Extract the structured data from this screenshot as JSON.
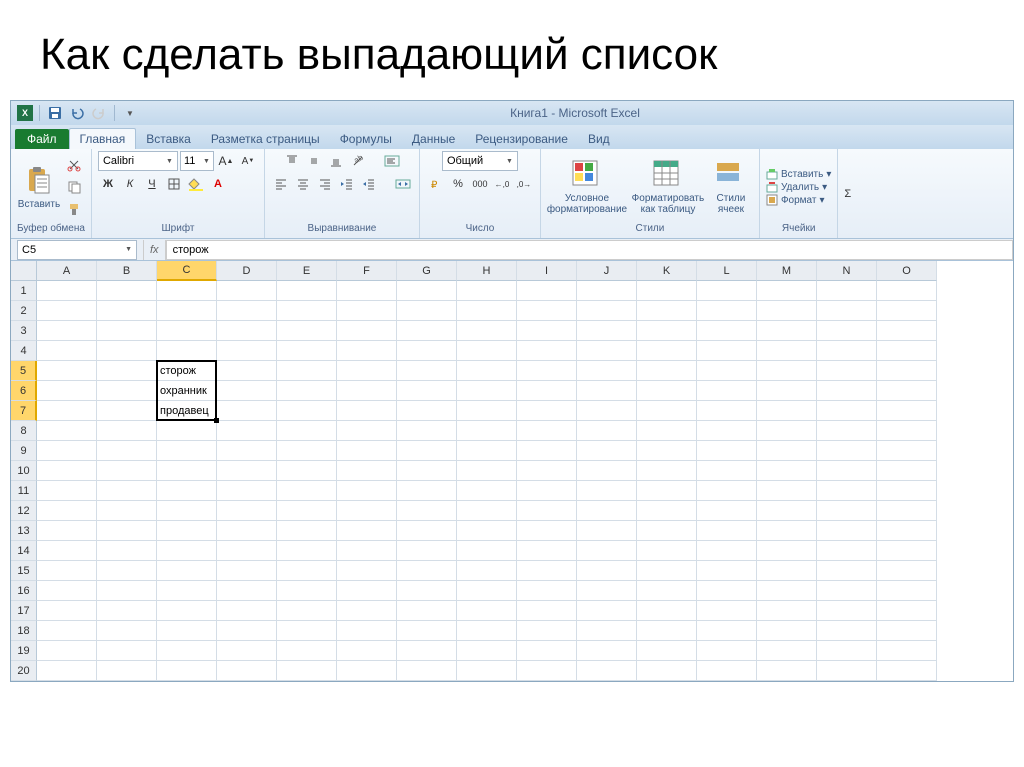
{
  "slide": {
    "title": "Как сделать выпадающий список"
  },
  "app": {
    "title": "Книга1  -  Microsoft Excel"
  },
  "tabs": {
    "file": "Файл",
    "items": [
      "Главная",
      "Вставка",
      "Разметка страницы",
      "Формулы",
      "Данные",
      "Рецензирование",
      "Вид"
    ],
    "active": 0
  },
  "ribbon": {
    "clipboard": {
      "paste": "Вставить",
      "label": "Буфер обмена"
    },
    "font": {
      "name": "Calibri",
      "size": "11",
      "label": "Шрифт"
    },
    "align": {
      "label": "Выравнивание"
    },
    "number": {
      "format": "Общий",
      "label": "Число"
    },
    "styles": {
      "cond": "Условное форматирование",
      "table": "Форматировать как таблицу",
      "cell": "Стили ячеек",
      "label": "Стили"
    },
    "cells": {
      "insert": "Вставить",
      "delete": "Удалить",
      "format": "Формат",
      "label": "Ячейки"
    }
  },
  "formula": {
    "namebox": "C5",
    "value": "сторож"
  },
  "grid": {
    "columns": [
      "A",
      "B",
      "C",
      "D",
      "E",
      "F",
      "G",
      "H",
      "I",
      "J",
      "K",
      "L",
      "M",
      "N",
      "O"
    ],
    "rows": 20,
    "selectedCol": 2,
    "selectedRows": [
      4,
      5,
      6
    ],
    "data": {
      "C5": "сторож",
      "C6": "охранник",
      "C7": "продавец"
    }
  }
}
